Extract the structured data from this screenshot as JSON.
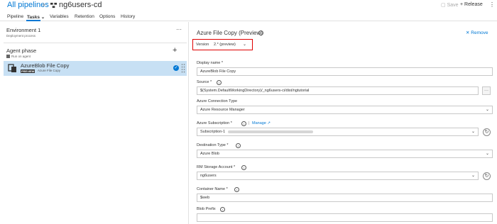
{
  "header": {
    "all_pipelines": "All pipelines",
    "separator": "›",
    "pipeline_name": "ng6users-cd",
    "save_label": "Save",
    "release_label": "Release",
    "more": "⋮"
  },
  "tabs": [
    {
      "label": "Pipeline"
    },
    {
      "label": "Tasks ⌄"
    },
    {
      "label": "Variables"
    },
    {
      "label": "Retention"
    },
    {
      "label": "Options"
    },
    {
      "label": "History"
    }
  ],
  "left": {
    "environment_title": "Environment 1",
    "environment_sub": "Deployment process",
    "environment_more": "···",
    "phase_title": "Agent phase",
    "phase_sub": "Run on agent",
    "phase_add": "+",
    "task_title": "AzureBlob File Copy",
    "task_badge": "PREVIEW",
    "task_sub": "Azure File Copy",
    "task_check": "✓"
  },
  "panel": {
    "title": "Azure File Copy (Preview)",
    "remove_label": "Remove",
    "version_label": "Version",
    "version_value": "2.* (preview)",
    "display_name_label": "Display name *",
    "display_name_value": "AzureBlob File Copy",
    "source_label": "Source *",
    "source_value": "$(System.DefaultWorkingDirectory)/_ng6users-ci/dist/ngtutorial",
    "source_browse": "···",
    "conn_type_label": "Azure Connection Type",
    "conn_type_value": "Azure Resource Manager",
    "subscription_label": "Azure Subscription *",
    "manage_label": "Manage",
    "subscription_value": "Subscription-1",
    "dest_type_label": "Destination Type *",
    "dest_type_value": "Azure Blob",
    "storage_label": "RM Storage Account *",
    "storage_value": "ng6users",
    "container_label": "Container Name *",
    "container_value": "$web",
    "blob_prefix_label": "Blob Prefix",
    "blob_prefix_value": ""
  },
  "colors": {
    "accent": "#0078d4",
    "highlight": "#c7e0f4",
    "version_border": "#e00000"
  }
}
